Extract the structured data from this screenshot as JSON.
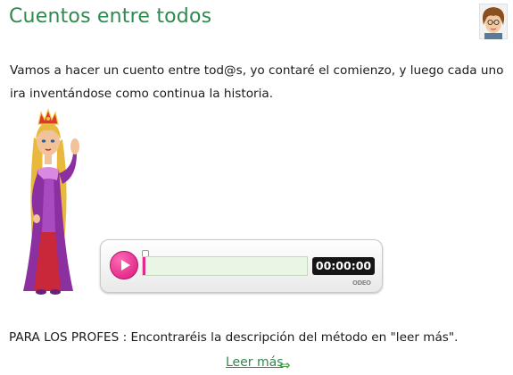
{
  "post": {
    "title": "Cuentos entre todos",
    "intro": "Vamos a hacer un cuento entre tod@s, yo contaré el comienzo, y luego cada uno ira inventándose como continua la historia.",
    "note": "PARA LOS PROFES : Encontraréis la descripción del método en \"leer más\".",
    "read_more_label": "Leer más"
  },
  "player": {
    "time": "00:00:00",
    "progress": 0,
    "brand": "ODEO",
    "play_icon": "play-icon",
    "accent_color": "#e3298a"
  },
  "icons": {
    "avatar": "author-avatar",
    "character": "princess-illustration",
    "read_more_arrow": "arrow-right-icon"
  },
  "colors": {
    "title": "#2e8a4e",
    "link": "#2e8a4e",
    "track": "#e9f6e6",
    "time_bg": "#161616"
  }
}
